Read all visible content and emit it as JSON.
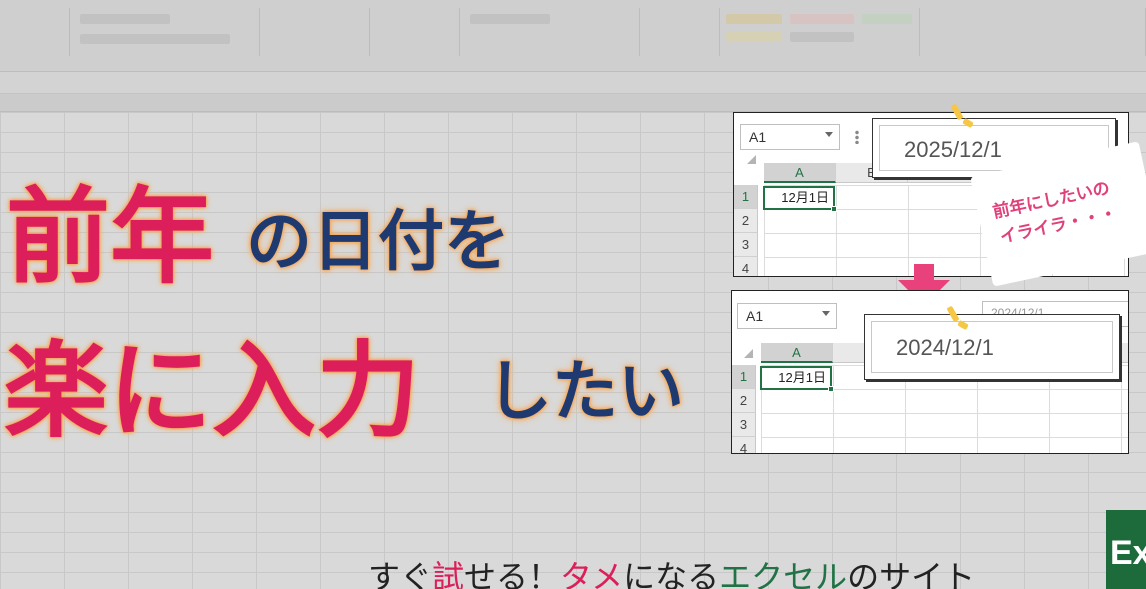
{
  "headline": {
    "line1_emphasis": "前年",
    "line1_rest": "の日付を",
    "line2_emphasis": "楽に入力",
    "line2_rest": "したい"
  },
  "panel_before": {
    "name_box": "A1",
    "formula_value": "2025/12/1",
    "column_a": "A",
    "column_b": "B",
    "rows": [
      "1",
      "2",
      "3",
      "4"
    ],
    "cell_a1": "12月1日"
  },
  "note": {
    "line1": "前年にしたいの",
    "line2": "イライラ・・・"
  },
  "panel_after": {
    "name_box": "A1",
    "formula_bar_background_value": "2024/12/1",
    "formula_value": "2024/12/1",
    "column_a": "A",
    "rows": [
      "1",
      "2",
      "3",
      "4"
    ],
    "cell_a1": "12月1日"
  },
  "footer": {
    "part1": "すぐ",
    "part2": "試",
    "part3": "せる！",
    "part4": "タメ",
    "part5": "になる",
    "part6": "エクセル",
    "part7": "のサイト"
  },
  "logo": {
    "text": "Ex"
  },
  "colors": {
    "pink": "#dc1f5a",
    "navy": "#1f3a70",
    "excel_green": "#217346",
    "glow_orange": "#f7a24a",
    "spark_yellow": "#f6c744",
    "arrow_pink": "#e8417c"
  }
}
